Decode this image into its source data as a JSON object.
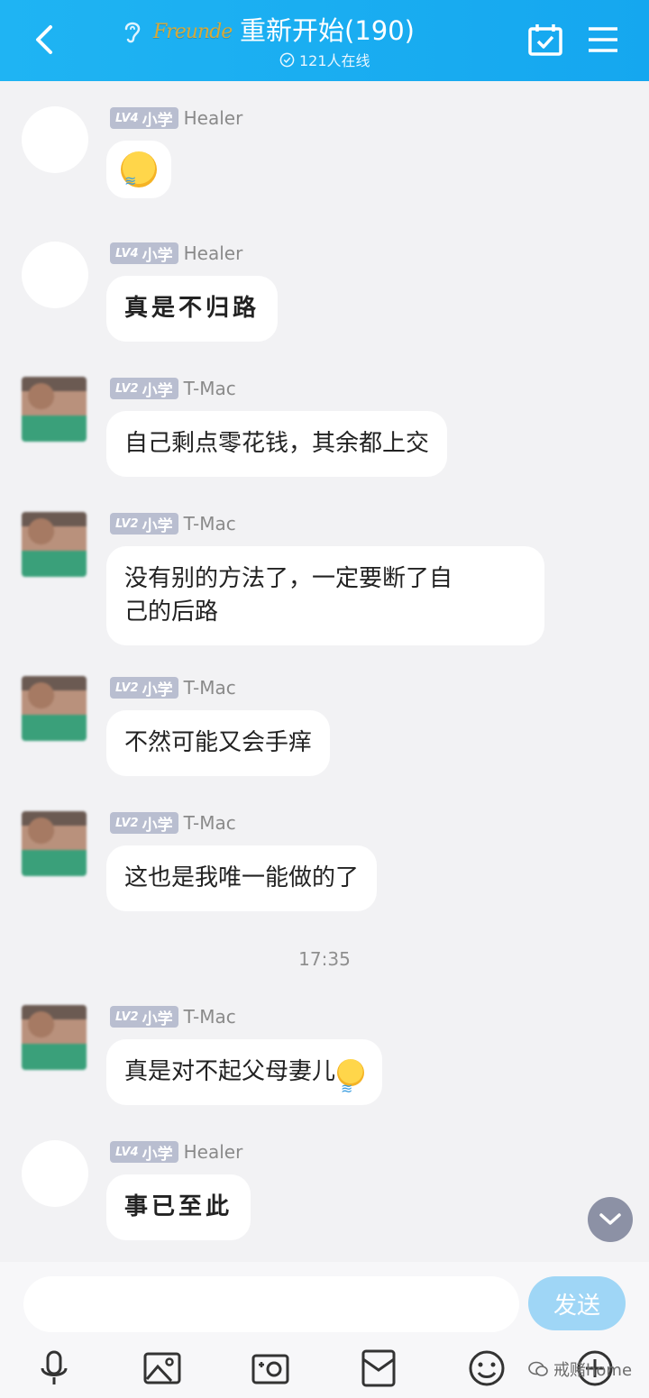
{
  "header": {
    "brand_logo": "Freunde",
    "title": "重新开始(190)",
    "online": "121人在线"
  },
  "messages": [
    {
      "badge_lv": "LV4",
      "badge_level": "小学",
      "name": "Healer",
      "text": "",
      "kind": "emoji"
    },
    {
      "badge_lv": "LV4",
      "badge_level": "小学",
      "name": "Healer",
      "text": "真是不归路",
      "kind": "hand"
    },
    {
      "badge_lv": "LV2",
      "badge_level": "小学",
      "name": "T-Mac",
      "text": "自己剩点零花钱，其余都上交"
    },
    {
      "badge_lv": "LV2",
      "badge_level": "小学",
      "name": "T-Mac",
      "line1": "没有别的方法了，一定要断了自",
      "line2": "己的后路"
    },
    {
      "badge_lv": "LV2",
      "badge_level": "小学",
      "name": "T-Mac",
      "text": "不然可能又会手痒"
    },
    {
      "badge_lv": "LV2",
      "badge_level": "小学",
      "name": "T-Mac",
      "text": "这也是我唯一能做的了"
    },
    {
      "badge_lv": "LV2",
      "badge_level": "小学",
      "name": "T-Mac",
      "text": "真是对不起父母妻儿"
    },
    {
      "badge_lv": "LV4",
      "badge_level": "小学",
      "name": "Healer",
      "text": "事已至此",
      "kind": "hand"
    }
  ],
  "timestamp": "17:35",
  "composer": {
    "placeholder": "",
    "send_label": "发送"
  },
  "watermark": "戒赌home",
  "colors": {
    "header": "#1fb4f3",
    "badge": "#b9bed0",
    "send": "#9fd6f6"
  }
}
